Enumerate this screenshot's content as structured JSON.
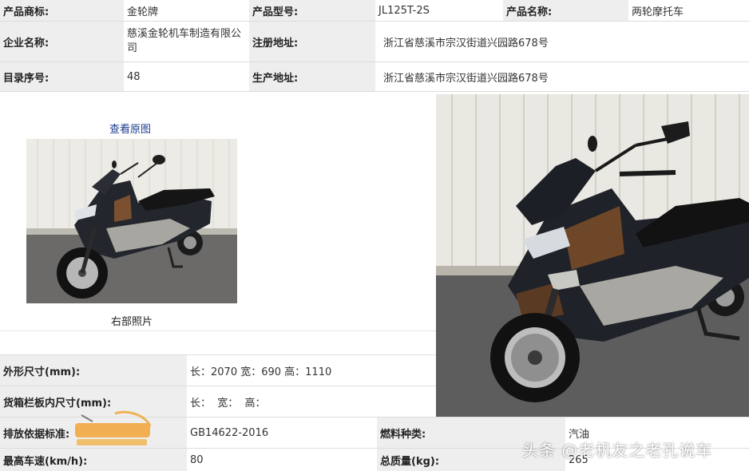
{
  "header_table": {
    "brand_label": "产品商标:",
    "brand_value": "金轮牌",
    "model_label": "产品型号:",
    "model_value": "JL125T-2S",
    "name_label": "产品名称:",
    "name_value": "两轮摩托车",
    "company_label": "企业名称:",
    "company_value": "慈溪金轮机车制造有限公司",
    "reg_addr_label": "注册地址:",
    "reg_addr_value": "浙江省慈溪市宗汉街道兴园路678号",
    "catalog_label": "目录序号:",
    "catalog_value": "48",
    "prod_addr_label": "生产地址:",
    "prod_addr_value": "浙江省慈溪市宗汉街道兴园路678号"
  },
  "photo_panel": {
    "view_original": "查看原图",
    "caption": "右部照片"
  },
  "specs_table": {
    "dims_label": "外形尺寸(mm):",
    "dims_value": "长：2070 宽：690 高：1110",
    "cargo_label": "货箱栏板内尺寸(mm):",
    "cargo_value": "长：  宽：  高：",
    "emission_label": "排放依据标准:",
    "emission_value": "GB14622-2016",
    "fuel_label": "燃料种类:",
    "fuel_value": "汽油",
    "speed_label": "最高车速(km/h):",
    "speed_value": "80",
    "mass_label": "总质量(kg):",
    "mass_value": "265"
  },
  "watermark": {
    "text": "头条 @老机友之老孔说车"
  },
  "colors": {
    "label_bg": "#eeeeee",
    "link": "#1a3d8f",
    "border": "#dddddd"
  }
}
